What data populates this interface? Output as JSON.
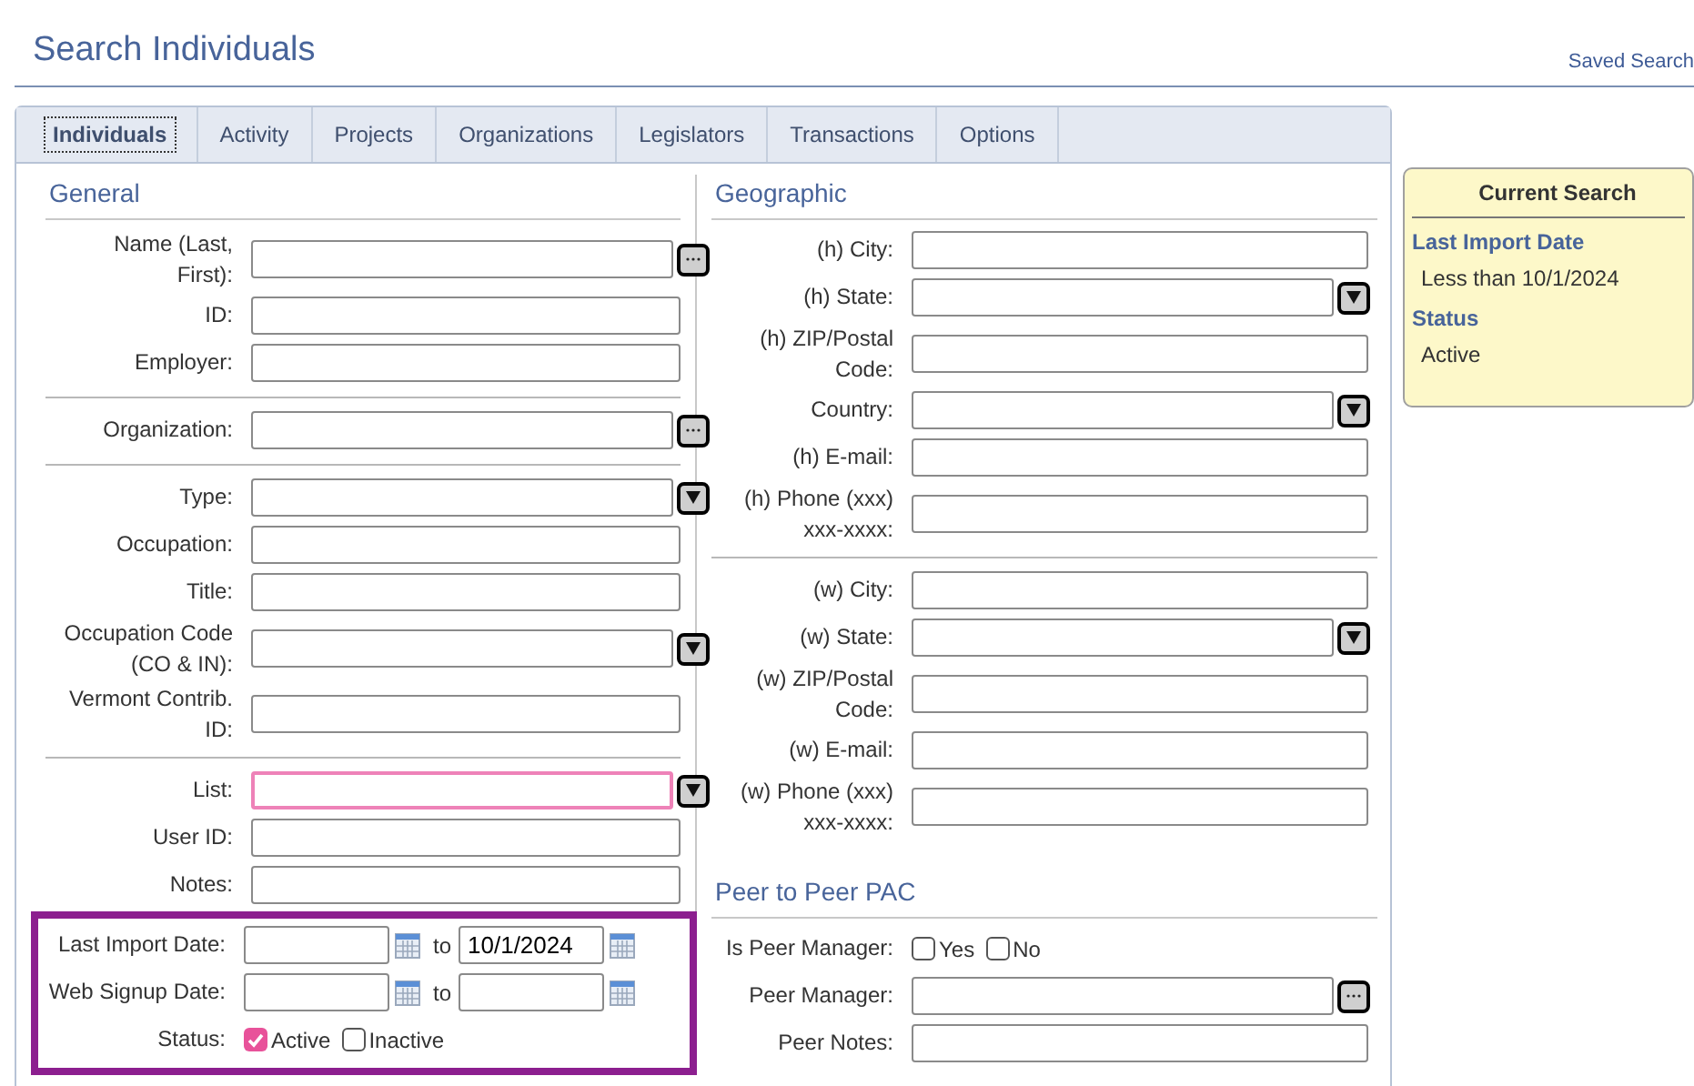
{
  "title": "Search Individuals",
  "saved_search_link": "Saved Search",
  "tabs": [
    {
      "label": "Individuals",
      "selected": true
    },
    {
      "label": "Activity",
      "selected": false
    },
    {
      "label": "Projects",
      "selected": false
    },
    {
      "label": "Organizations",
      "selected": false
    },
    {
      "label": "Legislators",
      "selected": false
    },
    {
      "label": "Transactions",
      "selected": false
    },
    {
      "label": "Options",
      "selected": false
    }
  ],
  "general": {
    "title": "General",
    "groups": [
      {
        "highlighted": false,
        "fields": [
          {
            "kind": "lookup",
            "label": "Name (Last, First):"
          },
          {
            "kind": "text",
            "label": "ID:"
          },
          {
            "kind": "text",
            "label": "Employer:"
          }
        ]
      },
      {
        "highlighted": false,
        "fields": [
          {
            "kind": "lookup",
            "label": "Organization:"
          }
        ]
      },
      {
        "highlighted": false,
        "fields": [
          {
            "kind": "select",
            "label": "Type:"
          },
          {
            "kind": "text",
            "label": "Occupation:"
          },
          {
            "kind": "text",
            "label": "Title:"
          },
          {
            "kind": "select",
            "label": "Occupation Code (CO & IN):"
          },
          {
            "kind": "text",
            "label": "Vermont Contrib. ID:"
          }
        ]
      },
      {
        "highlighted": false,
        "fields": [
          {
            "kind": "select",
            "label": "List:",
            "focused": true
          },
          {
            "kind": "text",
            "label": "User ID:"
          },
          {
            "kind": "text",
            "label": "Notes:"
          }
        ]
      },
      {
        "highlighted": true,
        "fields": [
          {
            "kind": "daterange",
            "label": "Last Import Date:",
            "to": "to",
            "to_value": "10/1/2024"
          },
          {
            "kind": "daterange",
            "label": "Web Signup Date:",
            "to": "to"
          },
          {
            "kind": "checks",
            "label": "Status:",
            "options": [
              {
                "label": "Active",
                "checked": true
              },
              {
                "label": "Inactive",
                "checked": false
              }
            ]
          }
        ]
      }
    ]
  },
  "geographic": {
    "title": "Geographic",
    "groups": [
      {
        "highlighted": false,
        "fields": [
          {
            "kind": "text",
            "label": "(h) City:"
          },
          {
            "kind": "select",
            "label": "(h) State:"
          },
          {
            "kind": "text",
            "label": "(h) ZIP/Postal Code:"
          },
          {
            "kind": "select",
            "label": "Country:"
          },
          {
            "kind": "text",
            "label": "(h) E-mail:"
          },
          {
            "kind": "text",
            "label": "(h) Phone (xxx) xxx-xxxx:"
          }
        ]
      },
      {
        "highlighted": false,
        "fields": [
          {
            "kind": "text",
            "label": "(w) City:"
          },
          {
            "kind": "select",
            "label": "(w) State:"
          },
          {
            "kind": "text",
            "label": "(w) ZIP/Postal Code:"
          },
          {
            "kind": "text",
            "label": "(w) E-mail:"
          },
          {
            "kind": "text",
            "label": "(w) Phone (xxx) xxx-xxxx:"
          }
        ]
      }
    ]
  },
  "peer": {
    "title": "Peer to Peer PAC",
    "groups": [
      {
        "highlighted": false,
        "fields": [
          {
            "kind": "checks",
            "label": "Is Peer Manager:",
            "options": [
              {
                "label": "Yes",
                "checked": false
              },
              {
                "label": "No",
                "checked": false
              }
            ]
          },
          {
            "kind": "lookup",
            "label": "Peer Manager:"
          },
          {
            "kind": "text",
            "label": "Peer Notes:"
          }
        ]
      }
    ]
  },
  "current_search": {
    "title": "Current Search",
    "items": [
      {
        "heading": "Last Import Date",
        "value": "Less than 10/1/2024"
      },
      {
        "heading": "Status",
        "value": "Active"
      }
    ]
  }
}
